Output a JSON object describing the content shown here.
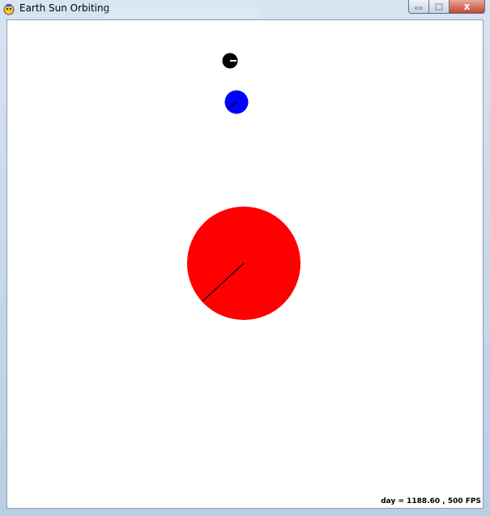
{
  "window": {
    "title": "Earth Sun Orbiting",
    "controls": {
      "minimize_icon": "minimize-icon",
      "maximize_icon": "maximize-icon",
      "close_icon": "close-icon",
      "close_glyph": "x"
    }
  },
  "hud": {
    "day_text": "day = 1188.60 , 500",
    "fps_label": "FPS"
  },
  "bodies": {
    "sun": {
      "color": "#ff0000"
    },
    "earth": {
      "color": "#0000ff"
    },
    "moon": {
      "color": "#000000"
    }
  },
  "colors": {
    "canvas_bg": "#ffffff",
    "rotation_line": "#000000"
  }
}
